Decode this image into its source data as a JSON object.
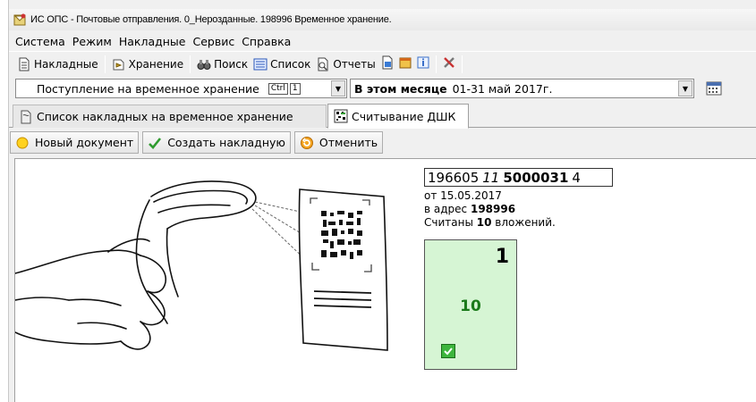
{
  "window": {
    "title": "ИС ОПС - Почтовые отправления. 0_Нерозданные. 198996 Временное хранение."
  },
  "menu": [
    "Система",
    "Режим",
    "Накладные",
    "Сервис",
    "Справка"
  ],
  "toolbar": {
    "invoices": "Накладные",
    "storage": "Хранение",
    "search": "Поиск",
    "list": "Список",
    "reports": "Отчеты"
  },
  "filter": {
    "mode": "Поступление на временное хранение",
    "ctrl_key": "Ctrl",
    "ctrl_num": "1",
    "period_label": "В этом месяце",
    "period_range": "01-31 май 2017г."
  },
  "tabs": {
    "list": "Список накладных на временное хранение",
    "scan": "Считывание ДШК"
  },
  "actions": {
    "new_doc": "Новый документ",
    "create_invoice": "Создать накладную",
    "cancel": "Отменить"
  },
  "scan": {
    "code_part1": "196605",
    "code_part2": "11",
    "code_part3": "5000031",
    "code_part4": "4",
    "date_line": "от 15.05.2017",
    "address_prefix": "в адрес",
    "address_value": "198996",
    "count_prefix": "Считаны",
    "count_value": "10",
    "count_suffix": "вложений."
  },
  "card": {
    "number": "1",
    "count": "10"
  },
  "colors": {
    "card_bg": "#d6f5d4",
    "count_text": "#1a7a1a",
    "check": "#3db53d"
  }
}
